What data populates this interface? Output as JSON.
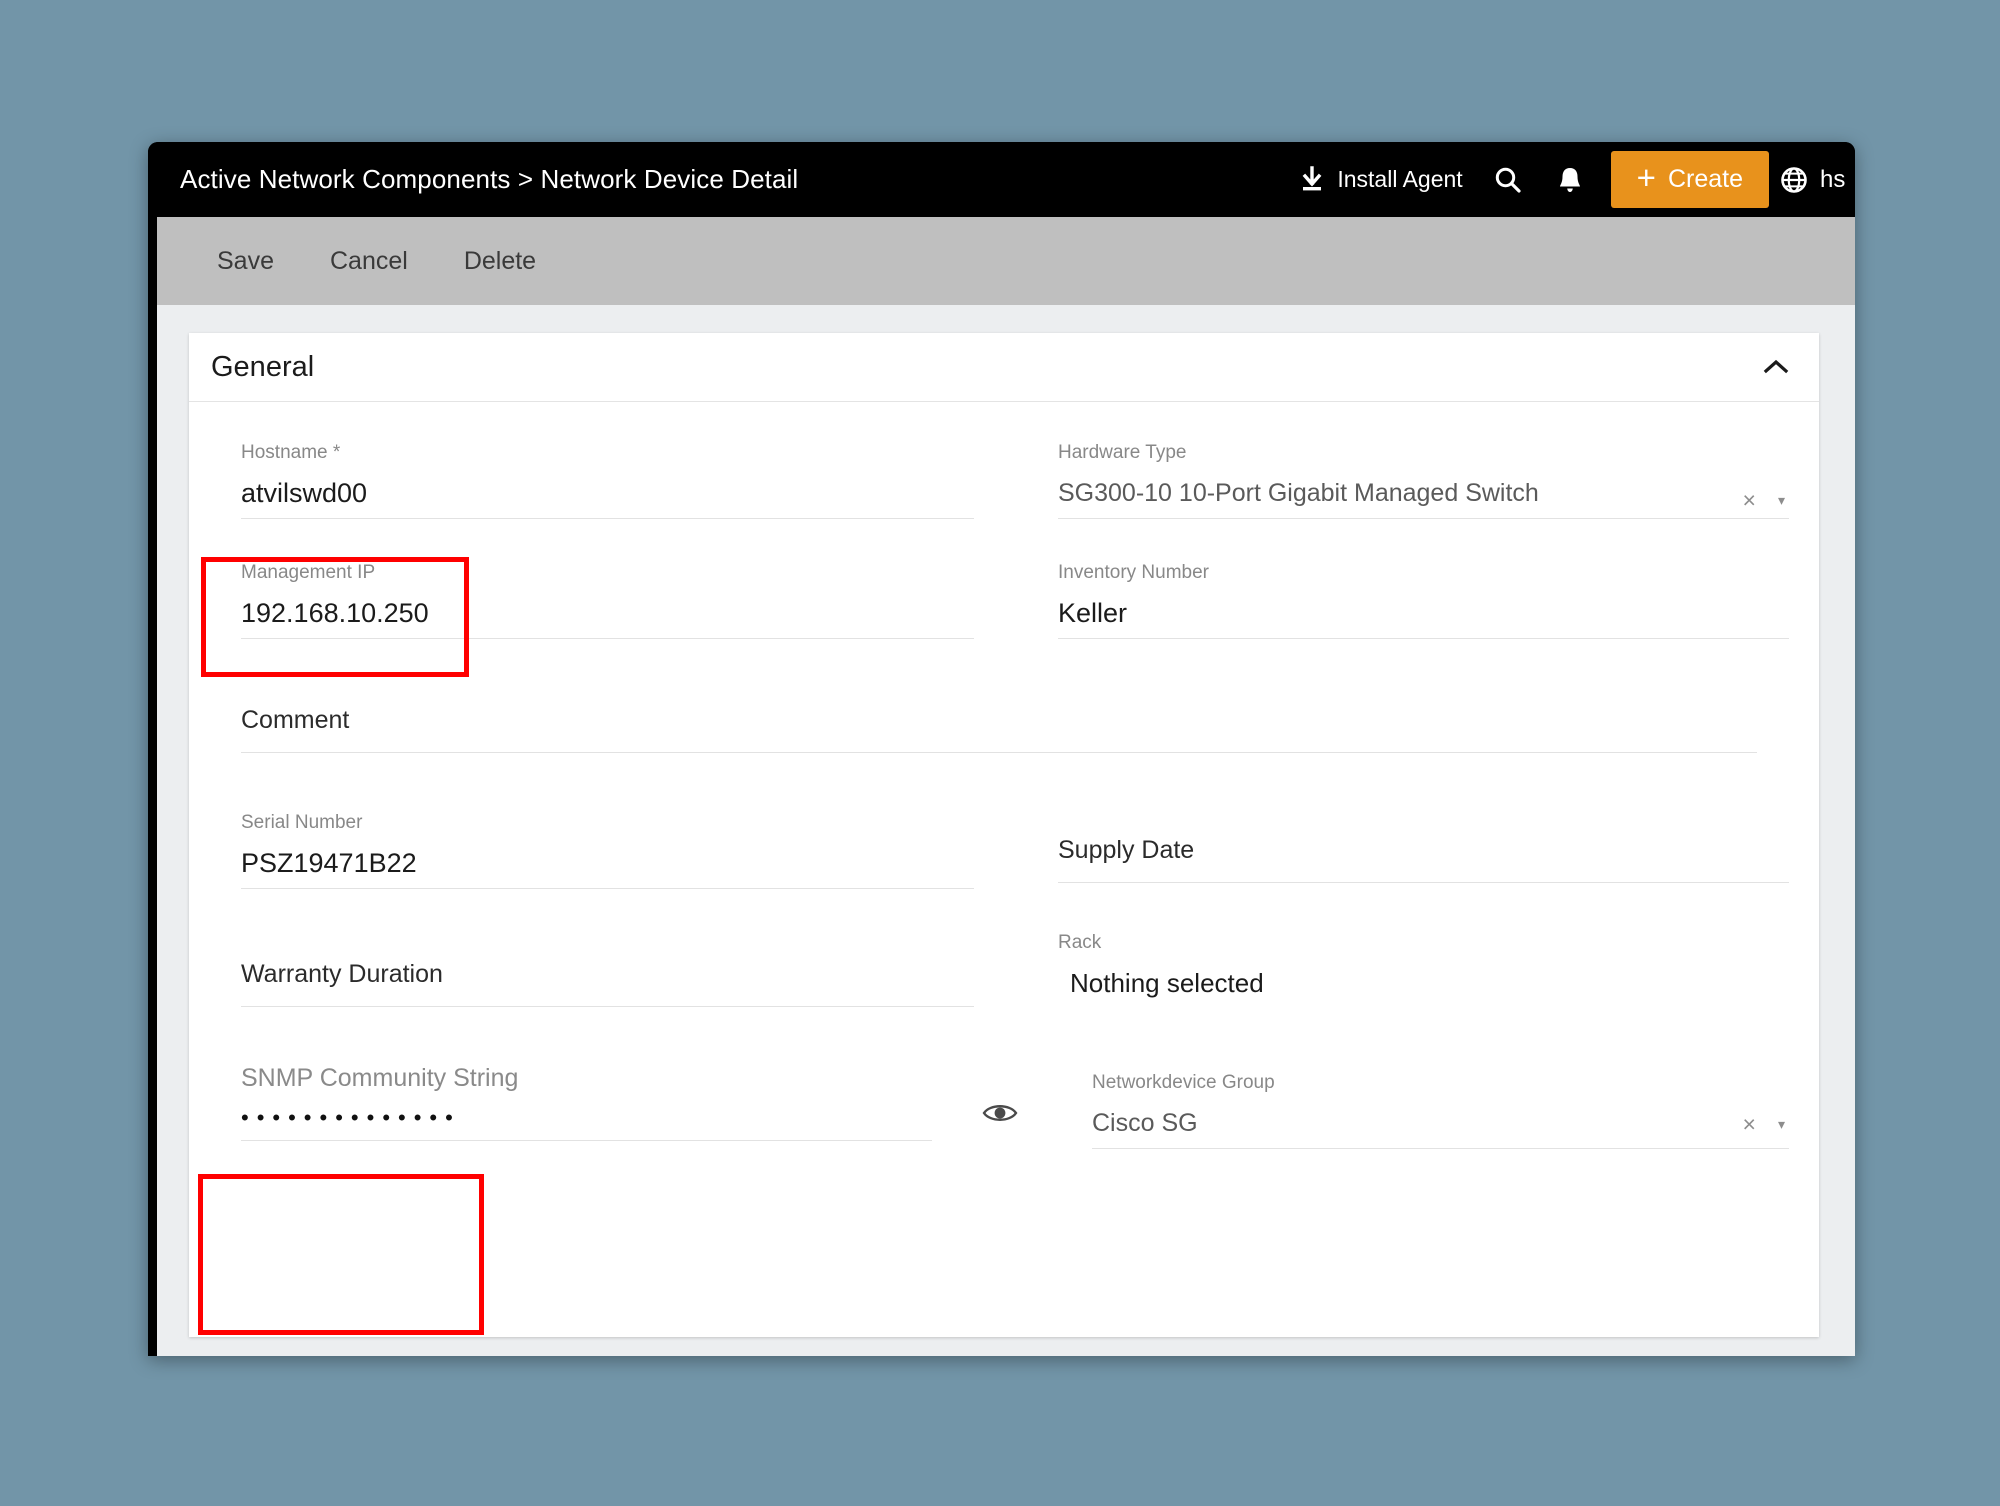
{
  "header": {
    "breadcrumb": "Active Network Components > Network Device Detail",
    "install_agent_label": "Install Agent",
    "install_agent_icon": "download-icon",
    "search_icon": "search-icon",
    "bell_icon": "bell-icon",
    "create_label": "Create",
    "create_plus": "+",
    "create_color": "#e8921c",
    "globe_icon": "globe-icon",
    "language_label": "hs"
  },
  "actionbar": {
    "save": "Save",
    "cancel": "Cancel",
    "delete": "Delete"
  },
  "panel": {
    "title": "General",
    "collapse_icon": "chevron-up-icon"
  },
  "fields": {
    "hostname": {
      "label": "Hostname *",
      "value": "atvilswd00"
    },
    "hardware_type": {
      "label": "Hardware Type",
      "value": "SG300-10 10-Port Gigabit Managed Switch",
      "clear": "×",
      "caret": "▾"
    },
    "management_ip": {
      "label": "Management IP",
      "value": "192.168.10.250",
      "highlighted": true
    },
    "inventory_number": {
      "label": "Inventory Number",
      "value": "Keller"
    },
    "comment": {
      "label": "Comment",
      "value": ""
    },
    "serial_number": {
      "label": "Serial Number",
      "value": "PSZ19471B22"
    },
    "supply_date": {
      "label": "Supply Date",
      "value": ""
    },
    "warranty_duration": {
      "label": "Warranty Duration",
      "value": ""
    },
    "rack": {
      "label": "Rack",
      "value": "Nothing selected"
    },
    "snmp_community_string": {
      "label": "SNMP Community String",
      "value": "••••••••••••••",
      "highlighted": true,
      "reveal_icon": "eye-icon"
    },
    "networkdevice_group": {
      "label": "Networkdevice Group",
      "value": "Cisco SG",
      "clear": "×",
      "caret": "▾"
    }
  },
  "annotations": {
    "highlight_color": "#ff0000",
    "boxes": [
      "management-ip",
      "snmp-community-string"
    ]
  }
}
